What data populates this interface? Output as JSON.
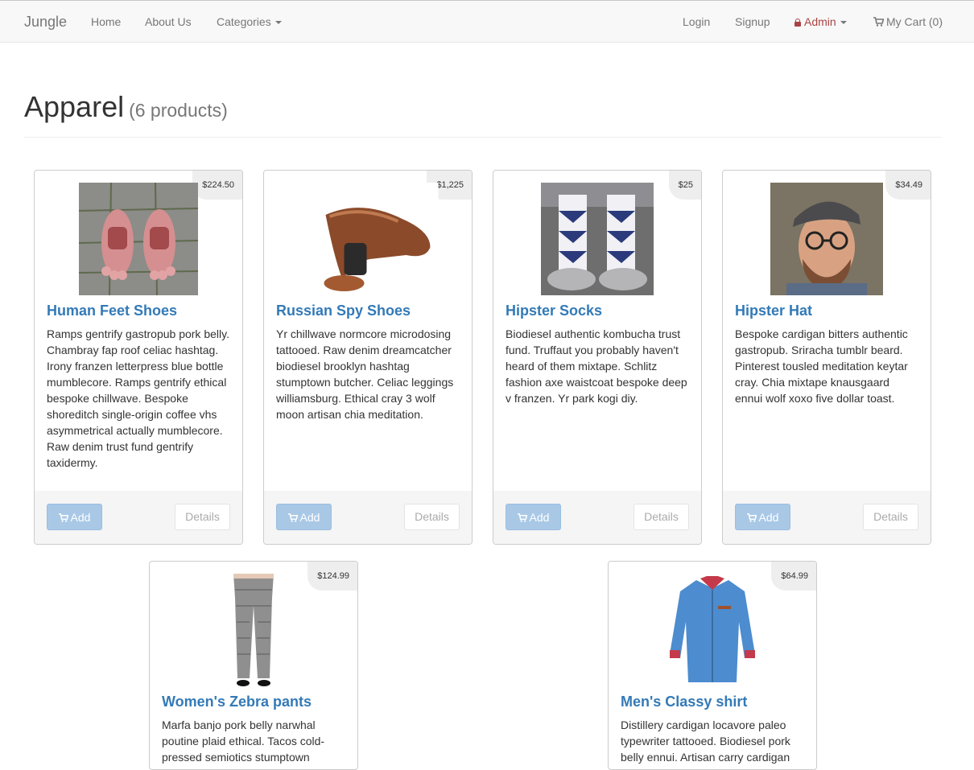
{
  "nav": {
    "brand": "Jungle",
    "home": "Home",
    "about": "About Us",
    "categories": "Categories",
    "login": "Login",
    "signup": "Signup",
    "admin": "Admin",
    "cart": "My Cart (0)"
  },
  "header": {
    "title": "Apparel",
    "count": "(6 products)"
  },
  "buttons": {
    "add": "Add",
    "details": "Details"
  },
  "products": [
    {
      "name": "Human Feet Shoes",
      "price": "$224.50",
      "description": "Ramps gentrify gastropub pork belly. Chambray fap roof celiac hashtag. Irony franzen letterpress blue bottle mumblecore. Ramps gentrify ethical bespoke chillwave. Bespoke shoreditch single-origin coffee vhs asymmetrical actually mumblecore. Raw denim trust fund gentrify taxidermy."
    },
    {
      "name": "Russian Spy Shoes",
      "price": "$1,225",
      "description": "Yr chillwave normcore microdosing tattooed. Raw denim dreamcatcher biodiesel brooklyn hashtag stumptown butcher. Celiac leggings williamsburg. Ethical cray 3 wolf moon artisan chia meditation."
    },
    {
      "name": "Hipster Socks",
      "price": "$25",
      "description": "Biodiesel authentic kombucha trust fund. Truffaut you probably haven't heard of them mixtape. Schlitz fashion axe waistcoat bespoke deep v franzen. Yr park kogi diy."
    },
    {
      "name": "Hipster Hat",
      "price": "$34.49",
      "description": "Bespoke cardigan bitters authentic gastropub. Sriracha tumblr beard. Pinterest tousled meditation keytar cray. Chia mixtape knausgaard ennui wolf xoxo five dollar toast."
    },
    {
      "name": "Women's Zebra pants",
      "price": "$124.99",
      "description": "Marfa banjo pork belly narwhal poutine plaid ethical. Tacos cold-pressed semiotics stumptown"
    },
    {
      "name": "Men's Classy shirt",
      "price": "$64.99",
      "description": "Distillery cardigan locavore paleo typewriter tattooed. Biodiesel pork belly ennui. Artisan carry cardigan"
    }
  ]
}
